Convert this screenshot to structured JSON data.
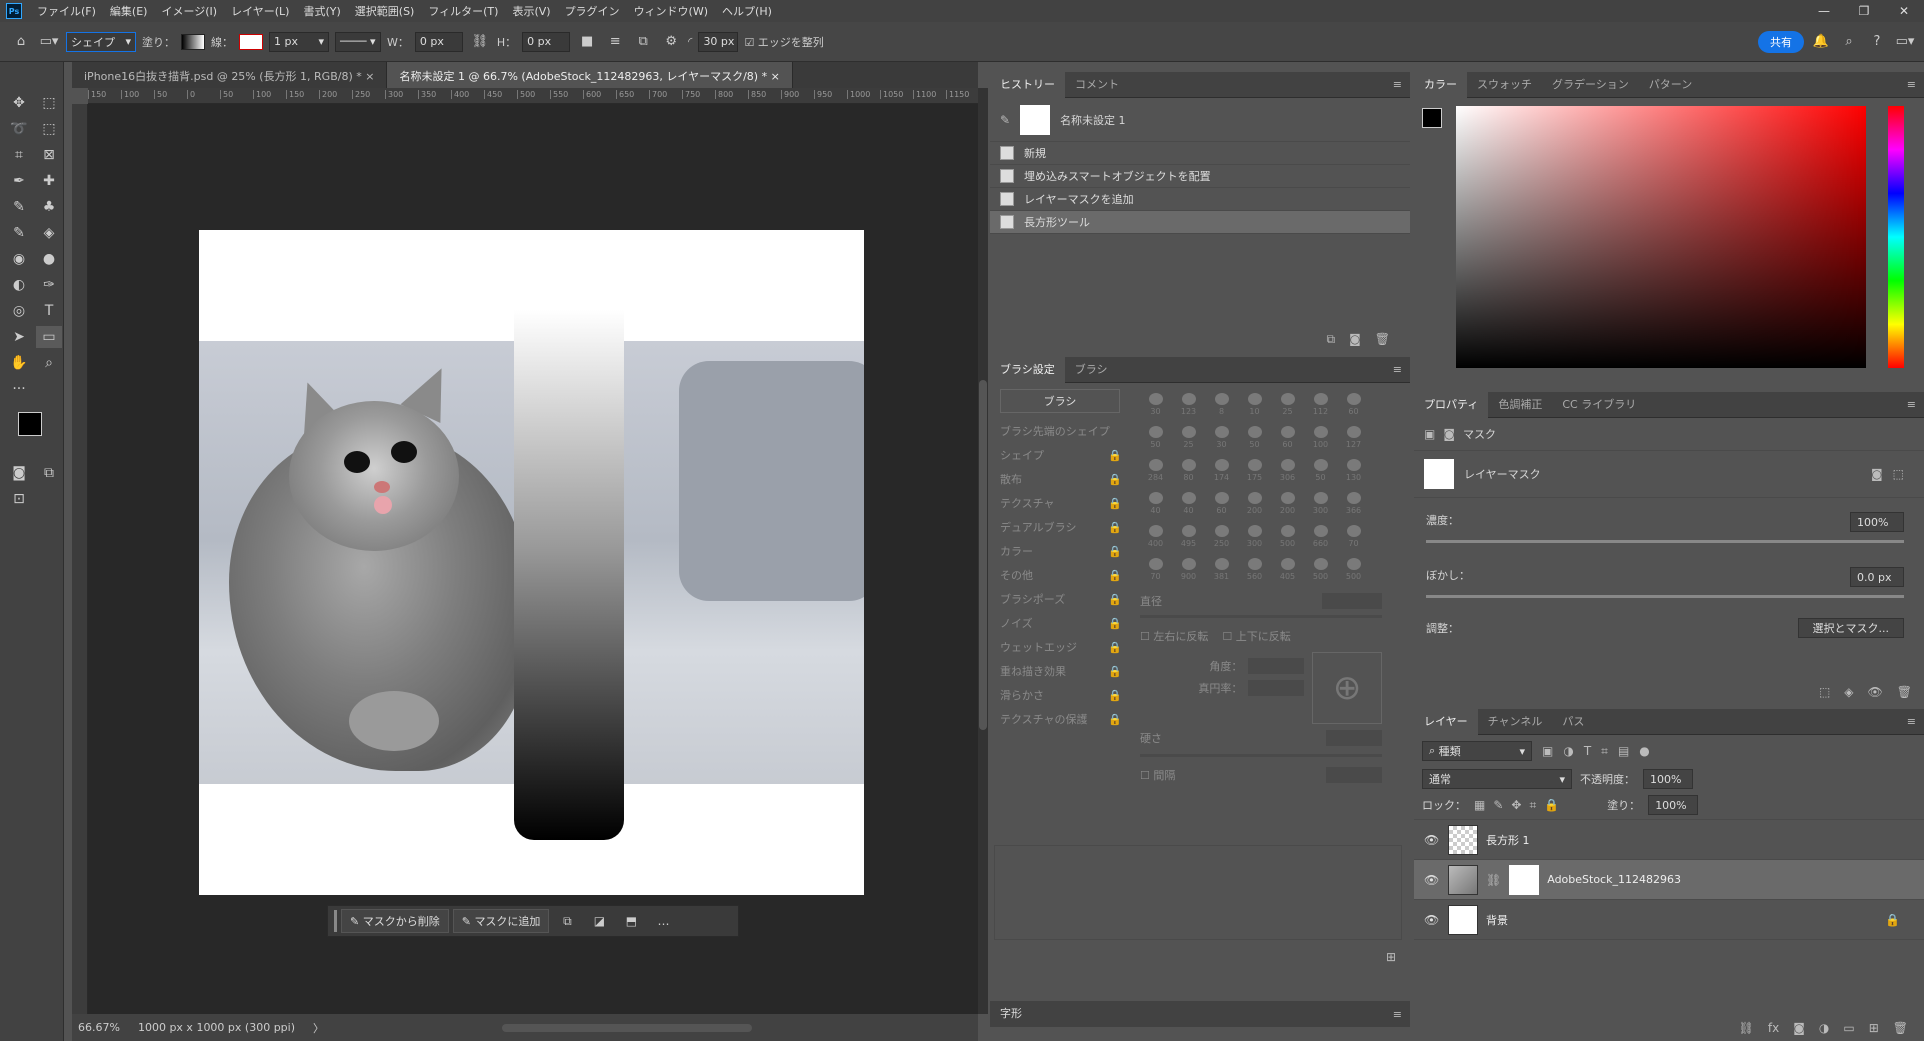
{
  "menubar": {
    "logo": "Ps",
    "items": [
      "ファイル(F)",
      "編集(E)",
      "イメージ(I)",
      "レイヤー(L)",
      "書式(Y)",
      "選択範囲(S)",
      "フィルター(T)",
      "表示(V)",
      "プラグイン",
      "ウィンドウ(W)",
      "ヘルプ(H)"
    ],
    "min": "—",
    "restore": "❐",
    "close": "✕"
  },
  "options": {
    "mode": "シェイプ",
    "fill_label": "塗り：",
    "stroke_label": "線：",
    "stroke_width": "1 px",
    "w_label": "W：",
    "w_value": "0 px",
    "h_label": "H：",
    "h_value": "0 px",
    "radius": "30 px",
    "align_edges": "エッジを整列",
    "share": "共有"
  },
  "doc_tabs": [
    {
      "label": "iPhone16白抜き描背.psd @ 25% (長方形 1, RGB/8) *",
      "close": "×"
    },
    {
      "label": "名称未設定 1 @ 66.7% (AdobeStock_112482963, レイヤーマスク/8) *",
      "close": "×"
    }
  ],
  "ruler_ticks": [
    "150",
    "100",
    "50",
    "0",
    "50",
    "100",
    "150",
    "200",
    "250",
    "300",
    "350",
    "400",
    "450",
    "500",
    "550",
    "600",
    "650",
    "700",
    "750",
    "800",
    "850",
    "900",
    "950",
    "1000",
    "1050",
    "1100",
    "1150"
  ],
  "mask_toolbar": {
    "remove": "マスクから削除",
    "add": "マスクに追加",
    "more": "…"
  },
  "status": {
    "zoom": "66.67%",
    "docinfo": "1000 px x 1000 px (300 ppi)",
    "arrow": "〉"
  },
  "history": {
    "tabs": [
      "ヒストリー",
      "コメント"
    ],
    "snapshot": "名称未設定 1",
    "items": [
      "新規",
      "埋め込みスマートオブジェクトを配置",
      "レイヤーマスクを追加",
      "長方形ツール"
    ]
  },
  "brush": {
    "tabs": [
      "ブラシ設定",
      "ブラシ"
    ],
    "button": "ブラシ",
    "options": [
      "ブラシ先端のシェイプ",
      "シェイプ",
      "散布",
      "テクスチャ",
      "デュアルブラシ",
      "カラー",
      "その他",
      "ブラシポーズ",
      "ノイズ",
      "ウェットエッジ",
      "重ね描き効果",
      "滑らかさ",
      "テクスチャの保護"
    ],
    "tip_sizes": [
      "30",
      "123",
      "8",
      "10",
      "25",
      "112",
      "60",
      "50",
      "25",
      "30",
      "50",
      "60",
      "100",
      "127",
      "284",
      "80",
      "174",
      "175",
      "306",
      "50",
      "130",
      "40",
      "40",
      "60",
      "200",
      "200",
      "300",
      "366",
      "400",
      "495",
      "250",
      "300",
      "500",
      "660",
      "70",
      "70",
      "900",
      "381",
      "560",
      "405",
      "500",
      "500"
    ],
    "diameter": "直径",
    "flip_x": "左右に反転",
    "flip_y": "上下に反転",
    "angle": "角度：",
    "roundness": "真円率：",
    "hardness": "硬さ",
    "spacing": "間隔"
  },
  "color": {
    "tabs": [
      "カラー",
      "スウォッチ",
      "グラデーション",
      "パターン"
    ],
    "hue": "#ff0000"
  },
  "properties": {
    "tabs": [
      "プロパティ",
      "色調補正",
      "CC ライブラリ"
    ],
    "type": "マスク",
    "layer_mask": "レイヤーマスク",
    "density_label": "濃度：",
    "density": "100%",
    "feather_label": "ぼかし：",
    "feather": "0.0 px",
    "adjust": "調整：",
    "select_mask": "選択とマスク..."
  },
  "layers": {
    "tabs": [
      "レイヤー",
      "チャンネル",
      "パス"
    ],
    "filter": "種類",
    "blend": "通常",
    "opacity_label": "不透明度：",
    "opacity": "100%",
    "lock_label": "ロック：",
    "fill_label": "塗り：",
    "fill": "100%",
    "rows": [
      {
        "name": "長方形 1"
      },
      {
        "name": "AdobeStock_112482963"
      },
      {
        "name": "背景"
      }
    ]
  },
  "char_panel": {
    "title": "字形"
  }
}
